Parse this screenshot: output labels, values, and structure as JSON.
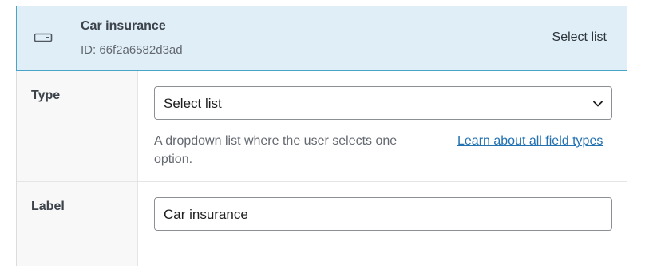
{
  "field": {
    "name": "Car insurance",
    "id_text": "ID: 66f2a6582d3ad",
    "type_display": "Select list",
    "icon": "select-field-icon"
  },
  "type_row": {
    "label": "Type",
    "selected": "Select list",
    "help_text": "A dropdown list where the user selects one option.",
    "link_text": "Learn about all field types"
  },
  "label_row": {
    "label": "Label",
    "value": "Car insurance"
  },
  "colors": {
    "header_bg": "#e0eef8",
    "header_border": "#4aa3c9",
    "link": "#2271b1"
  }
}
